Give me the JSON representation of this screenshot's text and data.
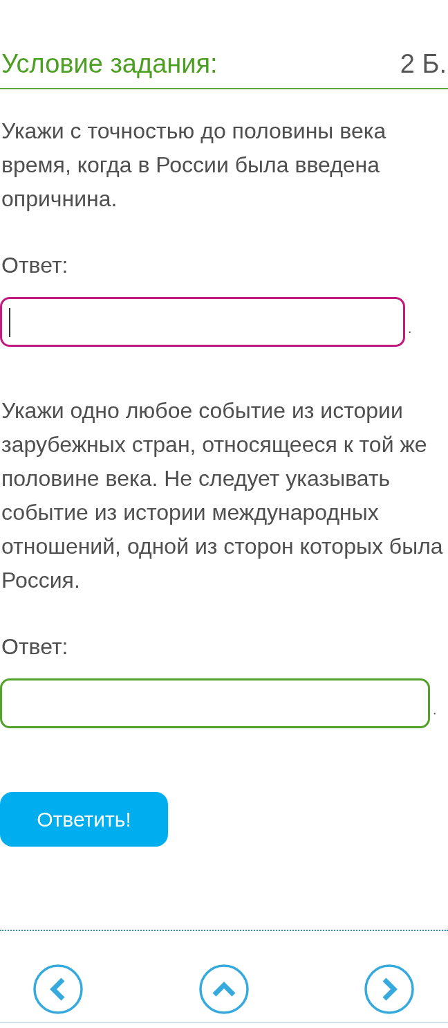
{
  "task": {
    "title": "Условие задания:",
    "points": "2 Б."
  },
  "questions": [
    {
      "prompt": "Укажи с точностью до половины века время, когда в России была введена опричнина.",
      "answer_label": "Ответ:",
      "field": {
        "focused": true,
        "suffix": "."
      }
    },
    {
      "prompt": "Укажи одно любое событие из истории зарубежных стран, относящееся к той же половине века. Не следует указывать событие из истории международных отношений, одной из сторон которых была Россия.",
      "answer_label": "Ответ:",
      "field": {
        "focused": false,
        "suffix": "."
      }
    }
  ],
  "submit_button": {
    "label": "Ответить!"
  },
  "navigation": [
    {
      "kind": "previous"
    },
    {
      "kind": "up"
    },
    {
      "kind": "next"
    }
  ]
}
